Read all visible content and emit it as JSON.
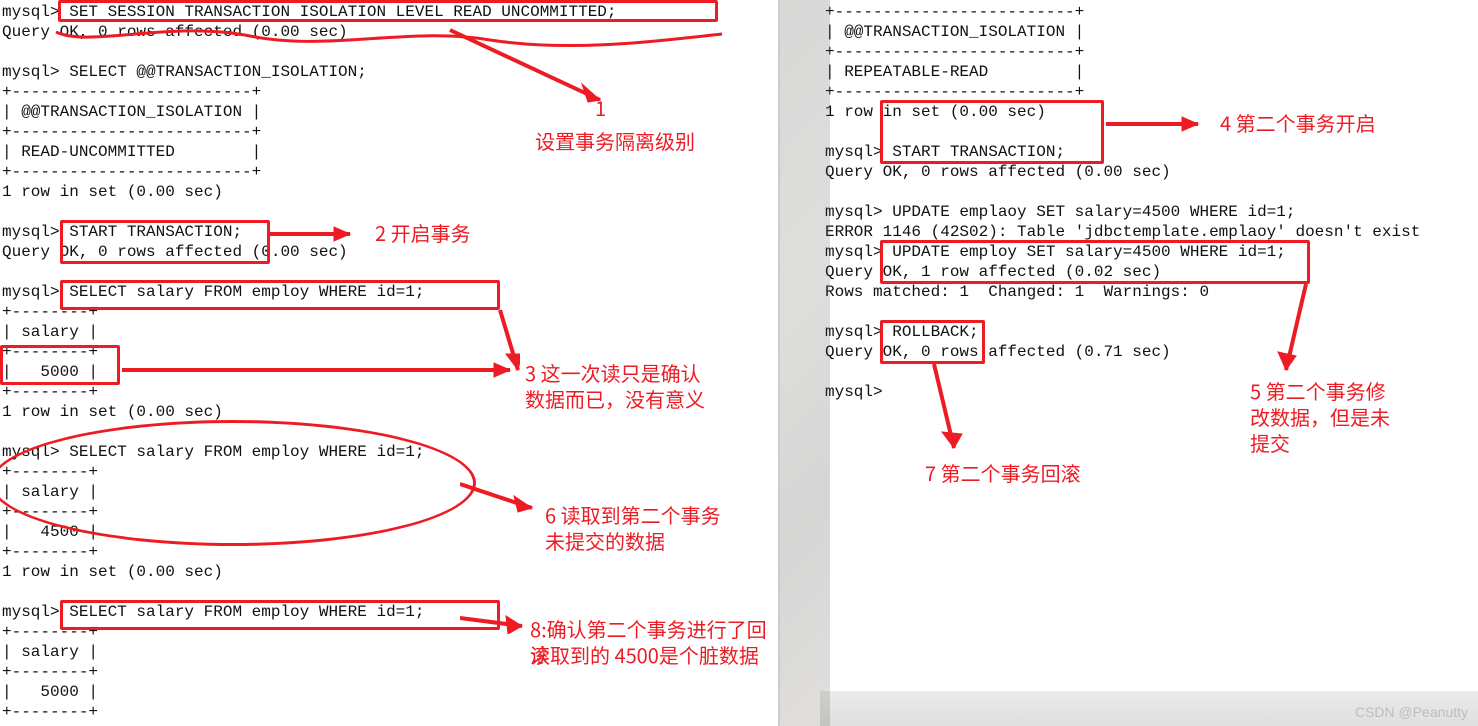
{
  "left_terminal": {
    "lines": [
      "mysql> SET SESSION TRANSACTION ISOLATION LEVEL READ UNCOMMITTED;",
      "Query OK, 0 rows affected (0.00 sec)",
      "",
      "mysql> SELECT @@TRANSACTION_ISOLATION;",
      "+-------------------------+",
      "| @@TRANSACTION_ISOLATION |",
      "+-------------------------+",
      "| READ-UNCOMMITTED        |",
      "+-------------------------+",
      "1 row in set (0.00 sec)",
      "",
      "mysql> START TRANSACTION;",
      "Query OK, 0 rows affected (0.00 sec)",
      "",
      "mysql> SELECT salary FROM employ WHERE id=1;",
      "+--------+",
      "| salary |",
      "+--------+",
      "|   5000 |",
      "+--------+",
      "1 row in set (0.00 sec)",
      "",
      "mysql> SELECT salary FROM employ WHERE id=1;",
      "+--------+",
      "| salary |",
      "+--------+",
      "|   4500 |",
      "+--------+",
      "1 row in set (0.00 sec)",
      "",
      "mysql> SELECT salary FROM employ WHERE id=1;",
      "+--------+",
      "| salary |",
      "+--------+",
      "|   5000 |",
      "+--------+"
    ]
  },
  "right_terminal": {
    "lines": [
      "+-------------------------+",
      "| @@TRANSACTION_ISOLATION |",
      "+-------------------------+",
      "| REPEATABLE-READ         |",
      "+-------------------------+",
      "1 row in set (0.00 sec)",
      "",
      "mysql> START TRANSACTION;",
      "Query OK, 0 rows affected (0.00 sec)",
      "",
      "mysql> UPDATE emplaoy SET salary=4500 WHERE id=1;",
      "ERROR 1146 (42S02): Table 'jdbctemplate.emplaoy' doesn't exist",
      "mysql> UPDATE employ SET salary=4500 WHERE id=1;",
      "Query OK, 1 row affected (0.02 sec)",
      "Rows matched: 1  Changed: 1  Warnings: 0",
      "",
      "mysql> ROLLBACK;",
      "Query OK, 0 rows affected (0.71 sec)",
      "",
      "mysql>"
    ]
  },
  "annotations": {
    "a1_num": "1",
    "a1_txt": "设置事务隔离级别",
    "a2": "2 开启事务",
    "a3_l1": "3  这一次读只是确认",
    "a3_l2": "数据而已，没有意义",
    "a6_l1": "6 读取到第二个事务",
    "a6_l2": "未提交的数据",
    "a8_l1": "8:确认第二个事务进行了回滚",
    "a8_l2": "读取到的 4500是个脏数据",
    "a4": "4  第二个事务开启",
    "a5_l1": "5  第二个事务修",
    "a5_l2": "改数据，但是未",
    "a5_l3": "提交",
    "a7": "7  第二个事务回滚"
  },
  "watermark": "CSDN @Peanutty"
}
